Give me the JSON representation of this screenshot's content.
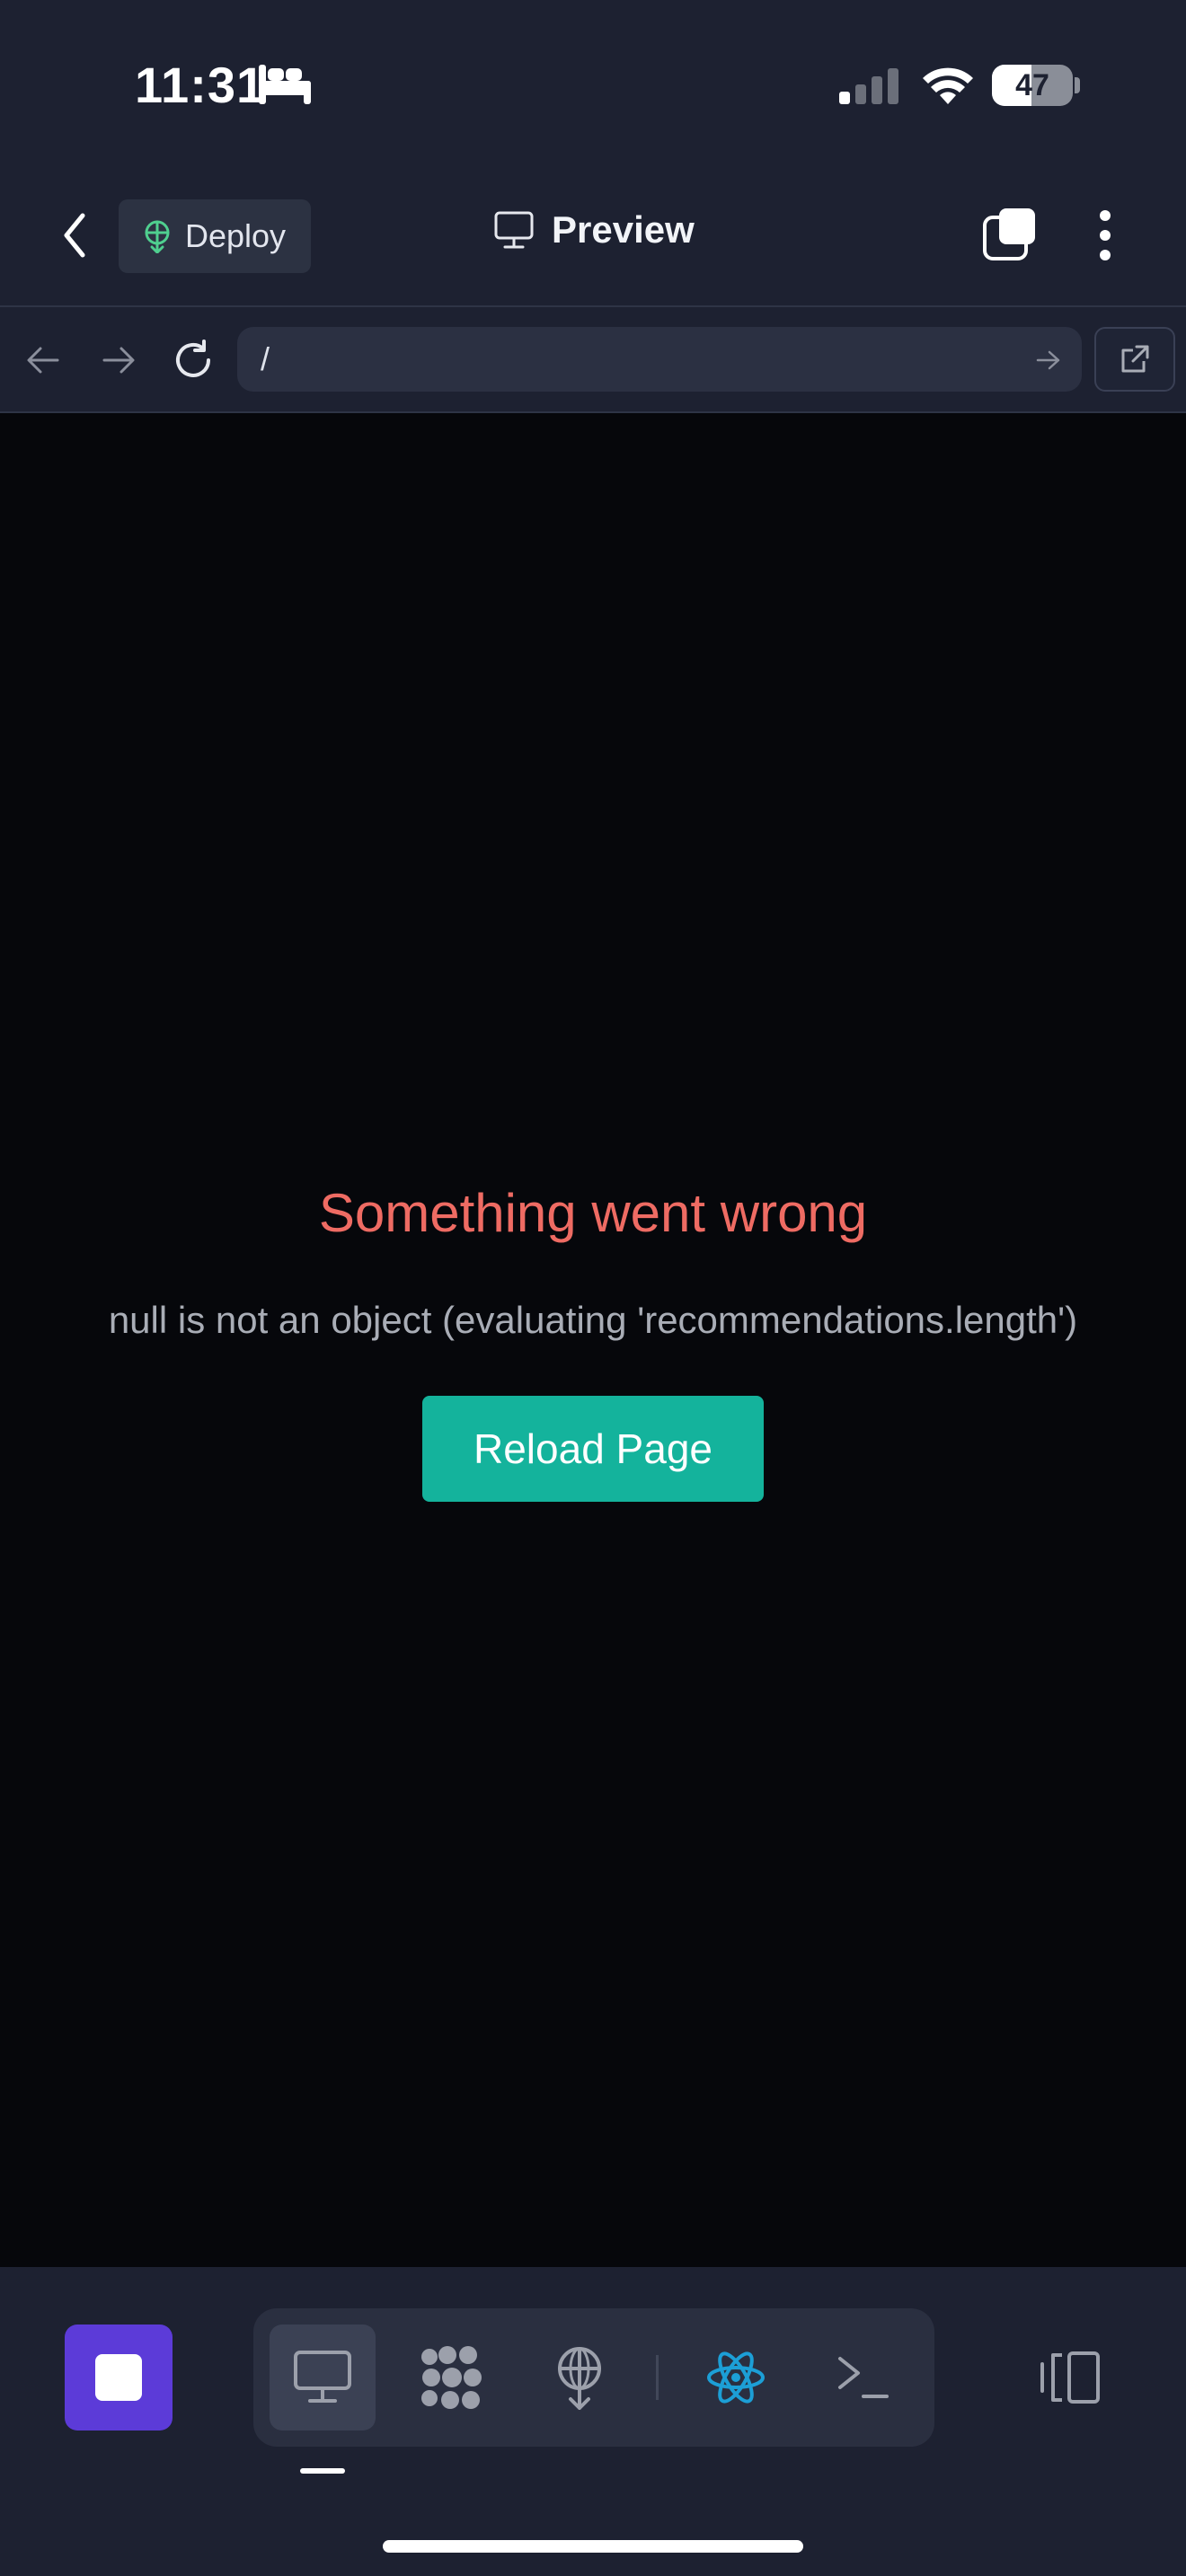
{
  "status_bar": {
    "time": "11:31",
    "battery": "47"
  },
  "header": {
    "deploy_label": "Deploy",
    "title": "Preview"
  },
  "url_bar": {
    "path": "/"
  },
  "error": {
    "title": "Something went wrong",
    "message": "null is not an object (evaluating 'recommendations.length')",
    "reload_label": "Reload Page"
  },
  "bottom_tabs": [
    "preview",
    "cluster",
    "deploy",
    "react",
    "terminal"
  ],
  "colors": {
    "accent": "#14b39c",
    "error": "#ee6b63",
    "stop": "#5c3bd8",
    "react": "#1c9fd6"
  }
}
